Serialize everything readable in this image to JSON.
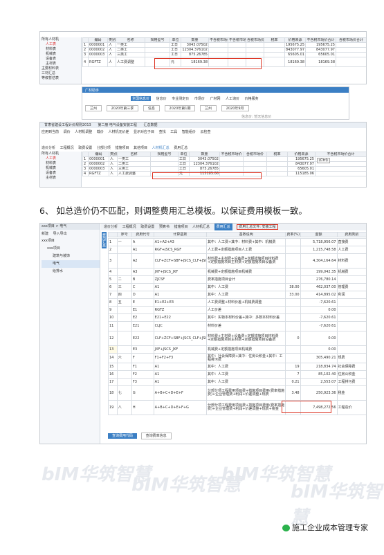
{
  "shot1": {
    "tree": [
      "所有人材机",
      "人工表",
      "材料表",
      "机械表",
      "设备表",
      "主材表",
      "主要材料表",
      "三材汇总",
      "等级暂估表"
    ],
    "headers": [
      "编码",
      "类别",
      "名称",
      "规格型号",
      "单位",
      "数量",
      "不含税市场价",
      "不含税市场价",
      "含税市场价",
      "税率",
      "价格来源",
      "不含税市场价合计",
      "含税市场价合计"
    ],
    "rows": [
      [
        "1",
        "0000001",
        "人",
        "一类工",
        "",
        "工日",
        "3043.07502",
        "",
        "",
        "",
        "",
        "195675.25",
        "195675.25"
      ],
      [
        "2",
        "0000002",
        "人",
        "二类工",
        "",
        "工日",
        "12304.376102",
        "",
        "",
        "",
        "",
        "843077.97",
        "843077.97"
      ],
      [
        "3",
        "0000003",
        "人",
        "三类工",
        "",
        "工日",
        "875.26785",
        "",
        "",
        "",
        "",
        "65605.01",
        "65605.01"
      ],
      [
        "4",
        "RGFTZ",
        "人",
        "人工费调整",
        "",
        "元",
        "18169.38",
        "",
        "",
        "",
        "",
        "18169.38",
        "18169.38"
      ]
    ]
  },
  "shot2": {
    "title": "广材助手",
    "tabs": [
      "全国信息价",
      "信息价",
      "专业测定价",
      "市场价",
      "广材网",
      "人工询价",
      "价格服务"
    ],
    "selectors": [
      "兰州",
      "2020年第三季",
      "信息",
      "2020年第1期",
      "兰州",
      "2020年9月"
    ],
    "status": "信息价: 暂无信息价"
  },
  "shot3": {
    "project_tabs": [
      "甘肃省建设工程计价规则2013",
      "第二册 电气设备安装工程",
      "汇总数据"
    ],
    "toolbar": [
      "应用到当前",
      "调价",
      "人材机调整",
      "载价",
      "人材机无价差",
      "显示对应子目",
      "查找",
      "工具",
      "智能组价",
      "云检查"
    ],
    "nav": [
      "造价分析",
      "工程概况",
      "取费设置",
      "分部分项",
      "措施项目",
      "其他项目",
      "人材机汇总",
      "费用汇总"
    ],
    "tree": [
      "所有人材机",
      "人工表",
      "材料表",
      "机械表",
      "设备表",
      "主材表"
    ],
    "headers": [
      "编码",
      "类别",
      "名称",
      "规格型号",
      "单位",
      "数量",
      "不含税市场价",
      "含税市场价",
      "税率",
      "价格来源",
      "不含税市场价合计"
    ],
    "rows": [
      [
        "1",
        "0000001",
        "人",
        "一类工",
        "",
        "工日",
        "3043.07502",
        "",
        "",
        "",
        "195675.25"
      ],
      [
        "2",
        "0000002",
        "人",
        "二类工",
        "",
        "工日",
        "12304.376102",
        "",
        "",
        "",
        "843077.97"
      ],
      [
        "3",
        "0000003",
        "人",
        "三类工",
        "",
        "工日",
        "875.26785",
        "",
        "",
        "",
        "65605.01"
      ],
      [
        "4",
        "RGFTZ",
        "人",
        "人工费调整",
        "",
        "元",
        "115185.06",
        "",
        "",
        "",
        "115185.06"
      ]
    ],
    "ctrl_hint": "(Ctrl)"
  },
  "heading": "6、 如总造价仍不匹配，则调整费用汇总模板。以保证费用模板一致。",
  "shot4": {
    "project": "xxx项目 > 电气",
    "actions": [
      "新建",
      "导入导出"
    ],
    "tree": [
      "xxx项目",
      "xxx项目",
      "建筑与装饰",
      "电气",
      "给排水"
    ],
    "tabs": [
      "造价分析",
      "工程概况",
      "取费设置",
      "预算书",
      "措施项目",
      "人材机汇总",
      "费用汇总"
    ],
    "tab_right": "费用汇总文件: 安装工程",
    "side_label": "费用汇总",
    "headers": [
      "序号",
      "费用代号",
      "计算基数",
      "基数说明",
      "费率(%)",
      "金额",
      "费用类别"
    ],
    "rows": [
      [
        "1",
        "一",
        "A",
        "A1+A2+A3",
        "其中：人工费+其中：材料费+其中：机械费",
        "",
        "5,718,956.07",
        "直接费"
      ],
      [
        "2",
        "",
        "A1",
        "RGF+JSCS_RGF",
        "人工费+定额措施项目人工费",
        "",
        "1,215,748.58",
        "人工费"
      ],
      [
        "3",
        "",
        "A2",
        "CLF+ZCF+SBF+JSCS_CLF+JSCS_ZCF+JSCS_SBF",
        "材料费+主材费+设备费+定额措施项目材料费+定额措施项目主材费+定额措施项目设备费",
        "",
        "4,304,164.64",
        "材料费"
      ],
      [
        "4",
        "",
        "A3",
        "JXF+JSCS_JXF",
        "机械费+定额措施项目机械费",
        "",
        "199,042.35",
        "机械费"
      ],
      [
        "5",
        "二",
        "B",
        "ZJCSF",
        "费率措施项目合计",
        "",
        "276,780.14",
        ""
      ],
      [
        "6",
        "三",
        "C",
        "A1",
        "其中：人工费",
        "38.00",
        "462,037.00",
        "管理费"
      ],
      [
        "7",
        "四",
        "D",
        "A1",
        "其中：人工费",
        "33.00",
        "414,895.02",
        "利润"
      ],
      [
        "8",
        "五",
        "E",
        "E1+E2+E3",
        "人工费调整+材料价差+机械费调整",
        "",
        "-7,620.61",
        ""
      ],
      [
        "9",
        "",
        "E1",
        "RGTZ",
        "人工价差",
        "",
        "0.00",
        ""
      ],
      [
        "10",
        "",
        "E2",
        "E21+E22",
        "其中：实物本材料价差+其中：多数本材料价差",
        "",
        "-7,620.61",
        ""
      ],
      [
        "11",
        "",
        "E21",
        "CLJC",
        "材料价差",
        "",
        "-7,620.61",
        ""
      ],
      [
        "12",
        "",
        "E22",
        "CLF+ZCF+SBF+JSCS_CLF+JSCS_ZCF+JSCS_SBF",
        "材料费+主材费+设备费+定额措施项目材料费+定额措施项目主材费+定额措施项目设备费",
        "0",
        "0.00",
        ""
      ],
      [
        "13",
        "",
        "E3",
        "JXF+JSCS_JXF",
        "机械费+定额措施项目机械费",
        "",
        "0.00",
        ""
      ],
      [
        "14",
        "六",
        "F",
        "F1+F2+F3",
        "其中：社会保障费+其中：住房公积金+其中：工程排污费",
        "",
        "305,490.21",
        "规费"
      ],
      [
        "15",
        "",
        "F1",
        "A1",
        "其中：人工费",
        "19",
        "218,834.74",
        "社会保障费"
      ],
      [
        "16",
        "",
        "F2",
        "A1",
        "其中：人工费",
        "7",
        "85,102.40",
        "住房公积金"
      ],
      [
        "17",
        "",
        "F3",
        "A1",
        "其中：人工费",
        "0.21",
        "2,553.07",
        "工程排污费"
      ],
      [
        "18",
        "七",
        "G",
        "A+B+C+D+E+F",
        "分部分项工程费用项目费+措施项目费用(费率措施费)+企业管理费+利润+价差调整+规费",
        "3.48",
        "250,923.36",
        "税金"
      ],
      [
        "19",
        "八",
        "H",
        "A+B+C+D+E+F+G",
        "分部分项工程费用项目费+措施项目费用(费率措施费)+企业管理费+利润+价差调整+规费+税金",
        "",
        "7,498,272.56",
        "工程造价"
      ]
    ],
    "bottom_tabs": [
      "查询费用代码",
      "查询费率信息"
    ]
  },
  "watermark": "bIM华筑智慧",
  "footer": "施工企业成本管理专家"
}
